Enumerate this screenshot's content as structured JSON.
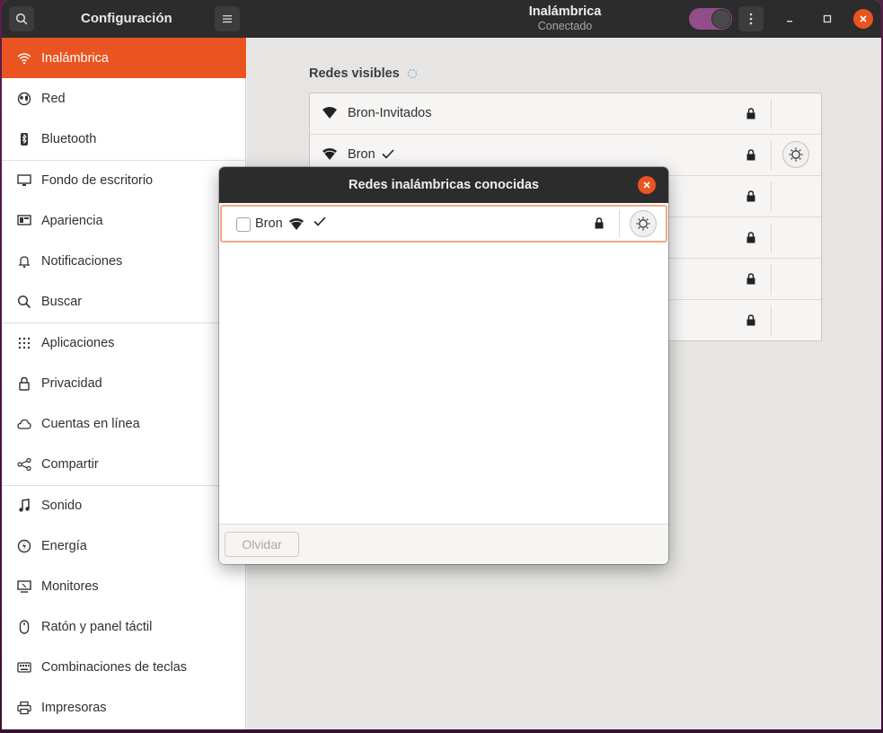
{
  "colors": {
    "accent": "#e95420",
    "header": "#2c2c2c",
    "toggle_on": "#924d8b"
  },
  "header": {
    "app_title": "Configuración",
    "page_title": "Inalámbrica",
    "page_subtitle": "Conectado",
    "wifi_toggle": "on"
  },
  "sidebar": {
    "items": [
      {
        "label": "Inalámbrica",
        "icon": "wifi-icon",
        "active": true
      },
      {
        "label": "Red",
        "icon": "network-icon"
      },
      {
        "label": "Bluetooth",
        "icon": "bluetooth-icon"
      },
      {
        "label": "Fondo de escritorio",
        "icon": "background-icon"
      },
      {
        "label": "Apariencia",
        "icon": "appearance-icon"
      },
      {
        "label": "Notificaciones",
        "icon": "bell-icon"
      },
      {
        "label": "Buscar",
        "icon": "search-icon"
      },
      {
        "label": "Aplicaciones",
        "icon": "apps-grid-icon"
      },
      {
        "label": "Privacidad",
        "icon": "lock-icon"
      },
      {
        "label": "Cuentas en línea",
        "icon": "cloud-icon"
      },
      {
        "label": "Compartir",
        "icon": "share-icon"
      },
      {
        "label": "Sonido",
        "icon": "music-note-icon"
      },
      {
        "label": "Energía",
        "icon": "power-icon"
      },
      {
        "label": "Monitores",
        "icon": "monitor-icon"
      },
      {
        "label": "Ratón y panel táctil",
        "icon": "mouse-icon"
      },
      {
        "label": "Combinaciones de teclas",
        "icon": "keyboard-icon"
      },
      {
        "label": "Impresoras",
        "icon": "printer-icon"
      }
    ]
  },
  "main": {
    "section_title": "Redes visibles",
    "networks": [
      {
        "name": "Bron-Invitados",
        "secured": true,
        "connected": false
      },
      {
        "name": "Bron",
        "secured": true,
        "connected": true
      }
    ]
  },
  "dialog": {
    "title": "Redes inalámbricas conocidas",
    "rows": [
      {
        "name": "Bron",
        "secured": true,
        "connected": true,
        "checked": false
      }
    ],
    "forget_label": "Olvidar"
  }
}
